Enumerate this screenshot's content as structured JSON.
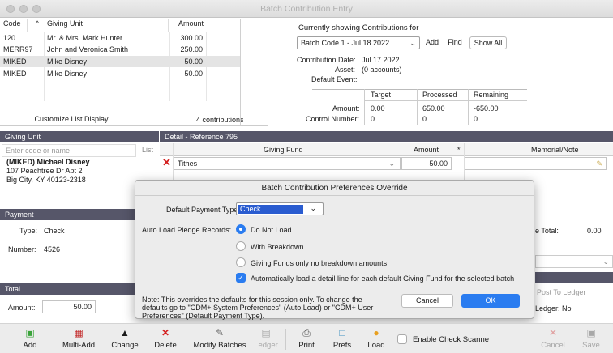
{
  "window": {
    "title": "Batch Contribution Entry"
  },
  "list": {
    "headers": {
      "code": "Code",
      "sort": "^",
      "giving_unit": "Giving Unit",
      "amount": "Amount"
    },
    "rows": [
      {
        "code": "120",
        "name": "Mr. & Mrs. Mark Hunter",
        "amount": "300.00"
      },
      {
        "code": "MERR97",
        "name": "John and Veronica Smith",
        "amount": "250.00"
      },
      {
        "code": "MIKED",
        "name": "Mike Disney",
        "amount": "50.00"
      },
      {
        "code": "MIKED",
        "name": "Mike Disney",
        "amount": "50.00"
      }
    ],
    "customize_button": "Customize List Display",
    "count": "4 contributions"
  },
  "batch": {
    "showing_label": "Currently showing Contributions for",
    "batch_select": "Batch Code 1 - Jul 18 2022",
    "add": "Add",
    "find": "Find",
    "show_all": "Show All",
    "contribution_date_label": "Contribution Date:",
    "contribution_date": "Jul 17 2022",
    "asset_label": "Asset:",
    "asset": "(0 accounts)",
    "default_event_label": "Default Event:",
    "col_target": "Target",
    "col_processed": "Processed",
    "col_remaining": "Remaining",
    "amount_label": "Amount:",
    "amount_target": "0.00",
    "amount_processed": "650.00",
    "amount_remaining": "-650.00",
    "control_label": "Control Number:",
    "control_target": "0",
    "control_processed": "0",
    "control_remaining": "0"
  },
  "giving_unit": {
    "header": "Giving Unit",
    "placeholder": "Enter code or name",
    "list_label": "List",
    "name": "(MIKED) Michael Disney",
    "address1": "107 Peachtree Dr  Apt 2",
    "address2": "Big City, KY  40123-2318"
  },
  "detail": {
    "header": "Detail - Reference 795",
    "col_fund": "Giving Fund",
    "col_amount": "Amount",
    "col_star": "*",
    "col_memo": "Memorial/Note",
    "fund": "Tithes",
    "amount": "50.00"
  },
  "payment": {
    "header": "Payment",
    "type_label": "Type:",
    "type": "Check",
    "number_label": "Number:",
    "number": "4526",
    "total_label": "e Total:",
    "total_value": "0.00"
  },
  "total": {
    "header": "Total",
    "amount_label": "Amount:",
    "amount": "50.00",
    "post_label": "Post To Ledger",
    "ledger_label": "Ledger: No"
  },
  "dialog": {
    "title": "Batch Contribution Preferences Override",
    "payment_type_label": "Default Payment Type:",
    "payment_type": "Check",
    "pledge_label": "Auto Load Pledge Records:",
    "opt1": "Do Not Load",
    "opt2": "With Breakdown",
    "opt3": "Giving Funds only no breakdown amounts",
    "auto_load": "Automatically load a detail line for each default Giving Fund for the selected batch",
    "note": "Note: This overrides the defaults for this session only. To change the defaults go to \"CDM+ System Preferences\" (Auto Load) or \"CDM+ User Preferences\" (Default Payment Type).",
    "cancel": "Cancel",
    "ok": "OK"
  },
  "toolbar": {
    "add": "Add",
    "multi_add": "Multi-Add",
    "change": "Change",
    "delete": "Delete",
    "modify": "Modify Batches",
    "ledger": "Ledger",
    "print": "Print",
    "prefs": "Prefs",
    "load": "Load",
    "enable_check": "Enable Check Scanne",
    "cancel": "Cancel",
    "save": "Save"
  },
  "colors": {
    "accent": "#2a7cf0",
    "header_bar": "#565669",
    "delete": "#d42020",
    "add_green": "#3aa33a"
  }
}
